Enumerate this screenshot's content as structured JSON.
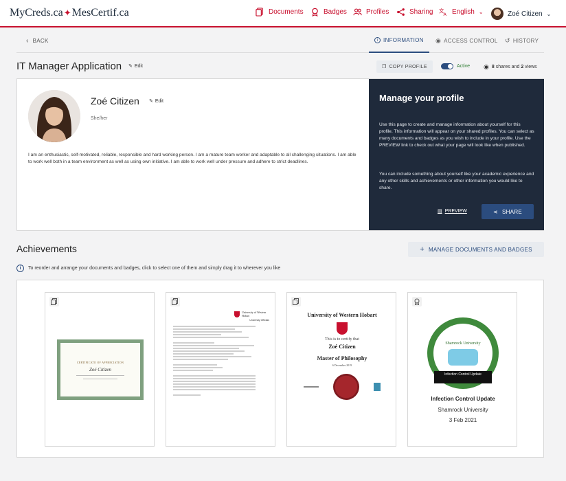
{
  "header": {
    "logo_en": "MyCreds.ca",
    "logo_fr": "MesCertif.ca",
    "nav": {
      "documents": "Documents",
      "badges": "Badges",
      "profiles": "Profiles",
      "sharing": "Sharing",
      "language": "English",
      "user": "Zoé Citizen"
    },
    "accent": "#c8102e"
  },
  "subheader": {
    "back": "BACK",
    "tabs": {
      "information": "INFORMATION",
      "access_control": "ACCESS CONTROL",
      "history": "HISTORY"
    },
    "active_tab": "INFORMATION"
  },
  "profile_bar": {
    "title": "IT Manager Application",
    "edit": "Edit",
    "copy_profile": "COPY PROFILE",
    "status": "Active",
    "shares": "8",
    "shares_label": "shares and",
    "views": "2",
    "views_label": "views"
  },
  "profile": {
    "name": "Zoé Citizen",
    "edit": "Edit",
    "pronouns": "She/her",
    "bio": "I am an enthusiastic, self-motivated, reliable, responsible and hard working person. I am a mature team worker and adaptable to all challenging situations. I am able to work well both in a team environment as well as using own initiative. I am able to work well under pressure and adhere to strict deadlines."
  },
  "manage_panel": {
    "title": "Manage your profile",
    "para1": "Use this page to create and manage information about yourself for this profile. This information will appear on your shared profiles. You can select as many documents and badges as you wish to include in your profile. Use the PREVIEW link to check out what your page will look like when published.",
    "para2": "You can include something about yourself like your academic experience and any other skills and achievements or other information you would like to share.",
    "preview": "PREVIEW",
    "share": "SHARE"
  },
  "achievements": {
    "title": "Achievements",
    "manage_button": "MANAGE DOCUMENTS AND BADGES",
    "hint": "To reorder and arrange your documents and badges, click to select one of them and simply drag it to wherever you like",
    "cards": [
      {
        "type": "document-icon",
        "cert_title": "CERTIFICATE OF APPRECIATION",
        "cert_name": "Zoé Citizen"
      },
      {
        "type": "document-icon",
        "uni_short": "University of Western Hobart",
        "doc_header": "University Officials"
      },
      {
        "type": "document-icon",
        "uni": "University of Western Hobart",
        "certify": "This is to certify that",
        "name": "Zoé Citizen",
        "degree": "Master of Philosophy",
        "date": "6 December 2019"
      },
      {
        "type": "badge-icon",
        "badge_uni": "Shamrock University",
        "banner": "Infection Control Update",
        "name": "Infection Control Update",
        "issuer": "Shamrock University",
        "date": "3 Feb 2021"
      }
    ]
  }
}
